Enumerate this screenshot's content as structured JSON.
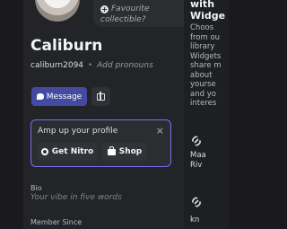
{
  "profile": {
    "favourite_line1": "Favourite",
    "favourite_line2": "collectible?",
    "display_name": "Caliburn",
    "username": "caliburn2094",
    "separator": "•",
    "add_pronouns": "Add pronouns",
    "message_label": "Message"
  },
  "promo": {
    "title": "Amp up your profile",
    "close": "×",
    "nitro_label": "Get Nitro",
    "shop_label": "Shop"
  },
  "bio": {
    "label": "Bio",
    "placeholder": "Your vibe in five words"
  },
  "member_since": {
    "label": "Member Since"
  },
  "widgets_panel": {
    "title_line1": "with",
    "title_line2": "Widge",
    "body_lines": [
      "Choos",
      "from ou",
      "library",
      "Widgets",
      "share m",
      "about",
      "yourse",
      "and yo",
      "interes"
    ],
    "item1_lines": [
      "Maa",
      "Riv"
    ],
    "item2_lines": [
      "kn"
    ]
  },
  "colors": {
    "accent": "#5865f2",
    "status_online": "#23a55a",
    "promo_border": "#7b6cf0"
  }
}
